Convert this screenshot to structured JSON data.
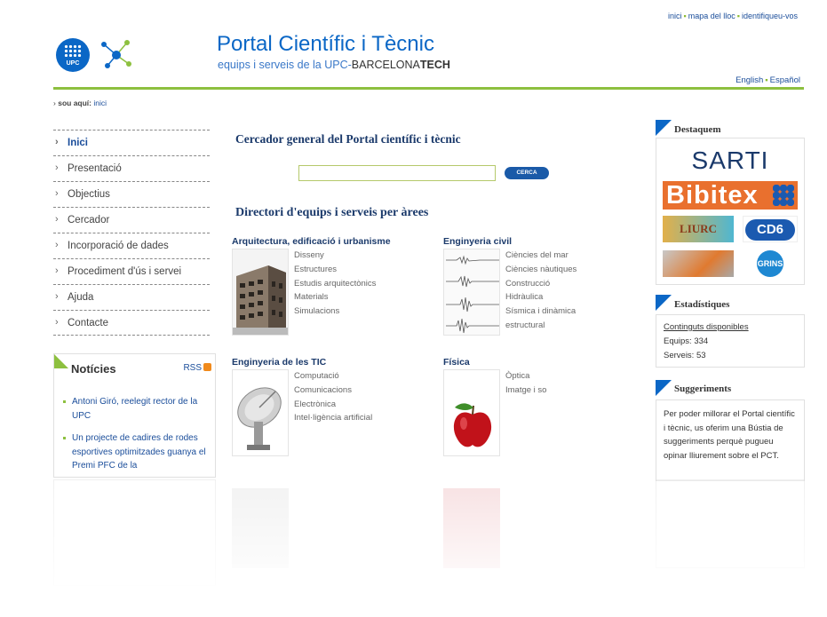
{
  "top_links": [
    "inici",
    "mapa del lloc",
    "identifiqueu-vos"
  ],
  "header": {
    "logo_text": "UPC",
    "title": "Portal Científic i Tècnic",
    "subtitle_part1": "equips i serveis de la UPC-",
    "subtitle_part2": "BARCELONA",
    "subtitle_part3": "TECH"
  },
  "languages": [
    "English",
    "Español"
  ],
  "breadcrumb": {
    "label": "sou aquí:",
    "link": "inici"
  },
  "nav": [
    {
      "label": "Inici",
      "active": true
    },
    {
      "label": "Presentació"
    },
    {
      "label": "Objectius"
    },
    {
      "label": "Cercador"
    },
    {
      "label": "Incorporació de dades"
    },
    {
      "label": "Procediment d'ús i servei"
    },
    {
      "label": "Ajuda"
    },
    {
      "label": "Contacte"
    }
  ],
  "news": {
    "title": "Notícies",
    "rss": "RSS",
    "items": [
      "Antoni Giró, reelegit rector de la UPC",
      "Un projecte de cadires de rodes esportives optimitzades guanya el Premi PFC de la"
    ]
  },
  "search": {
    "heading": "Cercador general del Portal científic i tècnic",
    "button": "CERCA",
    "value": ""
  },
  "directory": {
    "heading": "Directori d'equips i serveis per àrees",
    "areas": [
      {
        "title": "Arquitectura, edificació i urbanisme",
        "items": [
          "Disseny",
          "Estructures",
          "Estudis arquitectònics",
          "Materials",
          "Simulacions"
        ]
      },
      {
        "title": "Enginyeria civil",
        "items": [
          "Ciències del mar",
          "Ciències nàutiques",
          "Construcció",
          "Hidràulica",
          "Sísmica i dinàmica",
          "estructural"
        ]
      },
      {
        "title": "Enginyeria de les TIC",
        "items": [
          "Computació",
          "Comunicacions",
          "Electrònica",
          "Intel·ligència artificial"
        ]
      },
      {
        "title": "Física",
        "items": [
          "Òptica",
          "Imatge i so"
        ]
      }
    ]
  },
  "sidebar": {
    "featured_title": "Destaquem",
    "featured_logos": [
      "SARTI",
      "Bibitex",
      "LIURC",
      "CD6",
      "GRINS"
    ],
    "stats_title": "Estadístiques",
    "stats_link": "Continguts disponibles",
    "stats_equips": "Equips: 334",
    "stats_serveis": "Serveis: 53",
    "suggestions_title": "Suggeriments",
    "suggestions_text": "Per poder millorar el Portal científic i tècnic, us oferim una Bústia de suggeriments perquè pugueu opinar lliurement sobre el PCT."
  },
  "colors": {
    "brand_blue": "#0b67c6",
    "accent_green": "#8dc03f",
    "heading_navy": "#1b3a6b"
  }
}
